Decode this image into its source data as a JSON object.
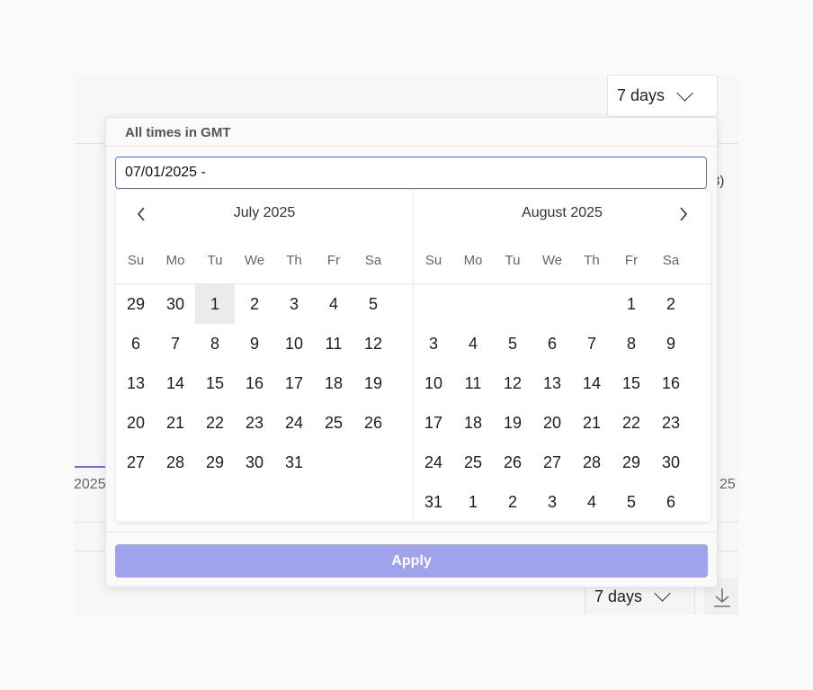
{
  "background": {
    "range_top": "7 days",
    "range_bottom": "7 days",
    "fragment_left": "2025",
    "fragment_right": "25",
    "fragment_paren": "3)"
  },
  "popover": {
    "timezone_label": "All times in GMT",
    "date_input_value": "07/01/2025 -",
    "apply_label": "Apply"
  },
  "calendar": {
    "weekdays": [
      "Su",
      "Mo",
      "Tu",
      "We",
      "Th",
      "Fr",
      "Sa"
    ],
    "months": [
      {
        "title": "July 2025",
        "weeks": [
          [
            "29",
            "30",
            "1",
            "2",
            "3",
            "4",
            "5"
          ],
          [
            "6",
            "7",
            "8",
            "9",
            "10",
            "11",
            "12"
          ],
          [
            "13",
            "14",
            "15",
            "16",
            "17",
            "18",
            "19"
          ],
          [
            "20",
            "21",
            "22",
            "23",
            "24",
            "25",
            "26"
          ],
          [
            "27",
            "28",
            "29",
            "30",
            "31",
            "",
            ""
          ]
        ],
        "selected_day": "1"
      },
      {
        "title": "August 2025",
        "weeks": [
          [
            "",
            "",
            "",
            "",
            "",
            "1",
            "2"
          ],
          [
            "3",
            "4",
            "5",
            "6",
            "7",
            "8",
            "9"
          ],
          [
            "10",
            "11",
            "12",
            "13",
            "14",
            "15",
            "16"
          ],
          [
            "17",
            "18",
            "19",
            "20",
            "21",
            "22",
            "23"
          ],
          [
            "24",
            "25",
            "26",
            "27",
            "28",
            "29",
            "30"
          ],
          [
            "31",
            "1",
            "2",
            "3",
            "4",
            "5",
            "6"
          ]
        ]
      }
    ]
  },
  "colors": {
    "accent": "#5b6ee1",
    "apply_button": "#9fa3ec",
    "selected_day_bg": "#ebebeb"
  }
}
